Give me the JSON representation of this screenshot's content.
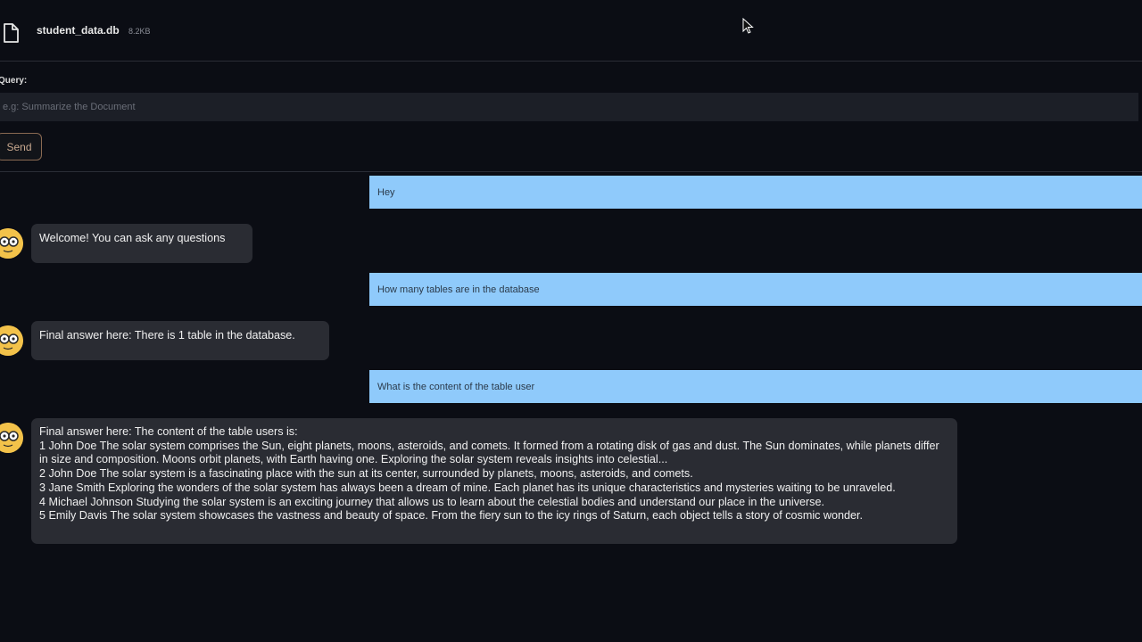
{
  "file": {
    "name": "student_data.db",
    "size": "8.2KB",
    "icon": "file-icon"
  },
  "query": {
    "label": "Query:",
    "placeholder": "e.g: Summarize the Document",
    "value": ""
  },
  "send": {
    "label": "Send"
  },
  "chat": {
    "messages": [
      {
        "role": "user",
        "text": "Hey"
      },
      {
        "role": "bot",
        "text": "Welcome! You can ask any questions"
      },
      {
        "role": "user",
        "text": "How many tables are in the database"
      },
      {
        "role": "bot",
        "text": "Final answer here: There is 1 table in the database."
      },
      {
        "role": "user",
        "text": "What is the content of the table user"
      },
      {
        "role": "bot",
        "intro": "Final answer here: The content of the table users is:",
        "rows": [
          "1 John Doe The solar system comprises the Sun, eight planets, moons, asteroids, and comets. It formed from a rotating disk of gas and dust. The Sun dominates, while planets differ in size and composition. Moons orbit planets, with Earth having one. Exploring the solar system reveals insights into celestial...",
          "2 John Doe The solar system is a fascinating place with the sun at its center, surrounded by planets, moons, asteroids, and comets.",
          "3 Jane Smith Exploring the wonders of the solar system has always been a dream of mine. Each planet has its unique characteristics and mysteries waiting to be unraveled.",
          "4 Michael Johnson Studying the solar system is an exciting journey that allows us to learn about the celestial bodies and understand our place in the universe.",
          "5 Emily Davis The solar system showcases the vastness and beauty of space. From the fiery sun to the icy rings of Saturn, each object tells a story of cosmic wonder."
        ]
      }
    ]
  },
  "colors": {
    "background": "#0b0d14",
    "user_bubble": "#8fcafb",
    "bot_bubble": "#2a2c33",
    "avatar": "#f3c24a",
    "send_border": "#8a6a52"
  }
}
